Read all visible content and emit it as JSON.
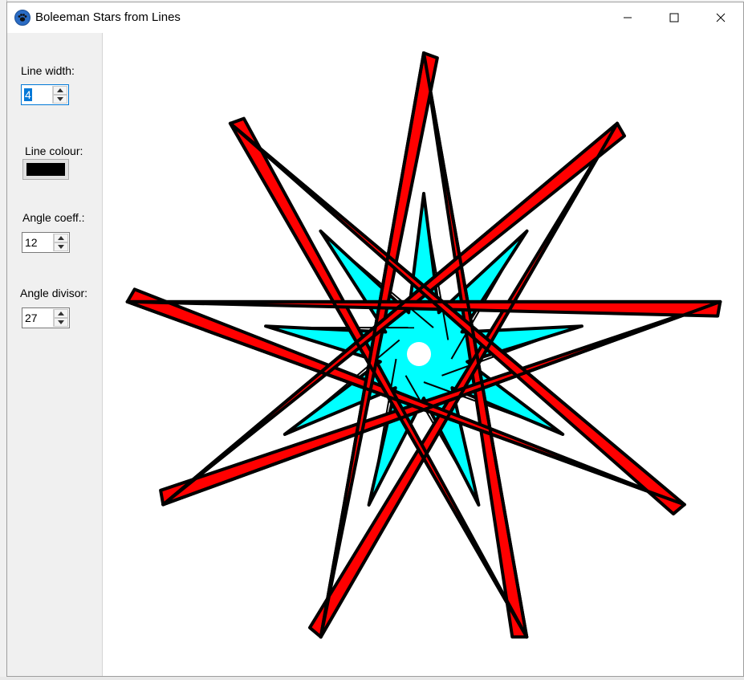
{
  "window": {
    "title": "Boleeman Stars from Lines",
    "app_icon": "paw-icon",
    "controls": [
      "minimize-icon",
      "maximize-icon",
      "close-icon"
    ]
  },
  "sidebar": {
    "line_width_label": "Line width:",
    "line_width_value": "4",
    "line_colour_label": "Line colour:",
    "line_colour_value": "#000000",
    "angle_coeff_label": "Angle coeff.:",
    "angle_coeff_value": "12",
    "angle_divisor_label": "Angle divisor:",
    "angle_divisor_value": "27"
  },
  "drawing": {
    "points": 9,
    "line_width": 4,
    "stroke_color": "#000000",
    "band_fill": "#ff0000",
    "gap_fill": "#00ffff",
    "background": "#ffffff"
  }
}
